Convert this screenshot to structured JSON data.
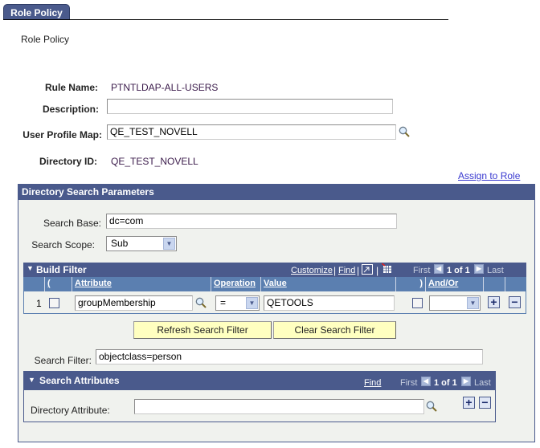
{
  "tab": {
    "label": "Role Policy"
  },
  "page_title": "Role Policy",
  "fields": {
    "rule_name_label": "Rule Name:",
    "rule_name_value": "PTNTLDAP-ALL-USERS",
    "description_label": "Description:",
    "description_value": "",
    "user_profile_map_label": "User Profile Map:",
    "user_profile_map_value": "QE_TEST_NOVELL",
    "directory_id_label": "Directory ID:",
    "directory_id_value": "QE_TEST_NOVELL"
  },
  "assign_link": "Assign to Role",
  "search_params": {
    "title": "Directory Search Parameters",
    "search_base_label": "Search Base:",
    "search_base_value": "dc=com",
    "search_scope_label": "Search Scope:",
    "search_scope_value": "Sub"
  },
  "build_filter": {
    "title": "Build Filter",
    "customize": "Customize",
    "find": "Find",
    "first": "First",
    "count": "1 of 1",
    "last": "Last",
    "columns": {
      "open_paren": "(",
      "attribute": "Attribute",
      "operation": "Operation",
      "value": "Value",
      "close_paren": ")",
      "and_or": "And/Or"
    },
    "rows": [
      {
        "num": "1",
        "attribute": "groupMembership",
        "operation": "=",
        "value": "QETOOLS",
        "and_or": ""
      }
    ]
  },
  "buttons": {
    "refresh": "Refresh Search Filter",
    "clear": "Clear Search Filter"
  },
  "search_filter": {
    "label": "Search Filter:",
    "value": "objectclass=person"
  },
  "search_attributes": {
    "title": "Search Attributes",
    "find": "Find",
    "first": "First",
    "count": "1 of 1",
    "last": "Last",
    "directory_attribute_label": "Directory Attribute:",
    "directory_attribute_value": ""
  },
  "icons": {
    "plus": "+",
    "minus": "−",
    "collapse": "▼",
    "prev": "◀",
    "next": "▶",
    "dropdown": "▼"
  }
}
